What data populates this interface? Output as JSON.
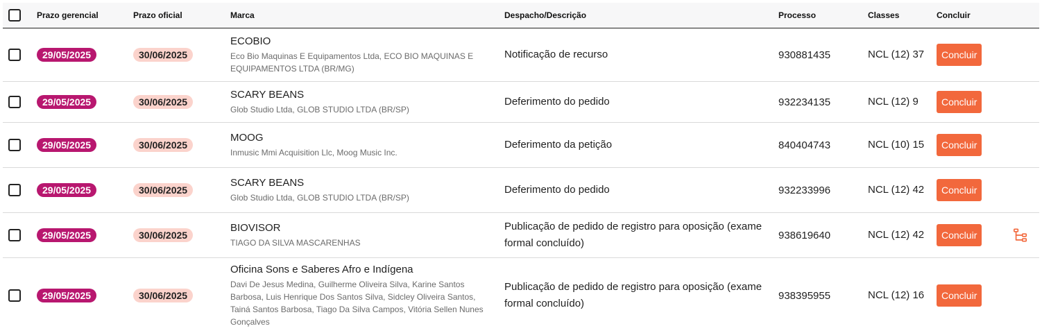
{
  "header": {
    "prazo_gerencial": "Prazo gerencial",
    "prazo_oficial": "Prazo oficial",
    "marca": "Marca",
    "despacho": "Despacho/Descrição",
    "processo": "Processo",
    "classes": "Classes",
    "concluir": "Concluir"
  },
  "colors": {
    "gerencial_pill": "#b8176f",
    "oficial_pill": "#fbd3cc",
    "concluir_button": "#f2683c",
    "tree_icon": "#f2683c"
  },
  "rows": [
    {
      "prazo_gerencial": "29/05/2025",
      "prazo_oficial": "30/06/2025",
      "marca": "ECOBIO",
      "titular": "Eco Bio Maquinas E Equipamentos Ltda, ECO BIO MAQUINAS E EQUIPAMENTOS LTDA (BR/MG)",
      "despacho": "Notificação de recurso",
      "processo": "930881435",
      "classes": "NCL (12) 37",
      "button_label": "Concluir"
    },
    {
      "prazo_gerencial": "29/05/2025",
      "prazo_oficial": "30/06/2025",
      "marca": "SCARY BEANS",
      "titular": "Glob Studio Ltda, GLOB STUDIO LTDA (BR/SP)",
      "despacho": "Deferimento do pedido",
      "processo": "932234135",
      "classes": "NCL (12) 9",
      "button_label": "Concluir"
    },
    {
      "prazo_gerencial": "29/05/2025",
      "prazo_oficial": "30/06/2025",
      "marca": "MOOG",
      "titular": "Inmusic Mmi Acquisition Llc, Moog Music Inc.",
      "despacho": "Deferimento da petição",
      "processo": "840404743",
      "classes": "NCL (10) 15",
      "button_label": "Concluir"
    },
    {
      "prazo_gerencial": "29/05/2025",
      "prazo_oficial": "30/06/2025",
      "marca": "SCARY BEANS",
      "titular": "Glob Studio Ltda, GLOB STUDIO LTDA (BR/SP)",
      "despacho": "Deferimento do pedido",
      "processo": "932233996",
      "classes": "NCL (12) 42",
      "button_label": "Concluir"
    },
    {
      "prazo_gerencial": "29/05/2025",
      "prazo_oficial": "30/06/2025",
      "marca": "BIOVISOR",
      "titular": "TIAGO DA SILVA MASCARENHAS",
      "despacho": "Publicação de pedido de registro para oposição (exame formal concluído)",
      "processo": "938619640",
      "classes": "NCL (12) 42",
      "button_label": "Concluir",
      "action_icon": "tree-structure-icon"
    },
    {
      "prazo_gerencial": "29/05/2025",
      "prazo_oficial": "30/06/2025",
      "marca": "Oficina Sons e Saberes Afro e Indígena",
      "titular": "Davi De Jesus Medina, Guilherme Oliveira Silva, Karine Santos Barbosa, Luis Henrique Dos Santos Silva, Sidcley Oliveira Santos, Tainá Santos Barbosa, Tiago Da Silva Campos, Vitória Sellen Nunes Gonçalves",
      "despacho": "Publicação de pedido de registro para oposição (exame formal concluído)",
      "processo": "938395955",
      "classes": "NCL (12) 16",
      "button_label": "Concluir"
    }
  ]
}
